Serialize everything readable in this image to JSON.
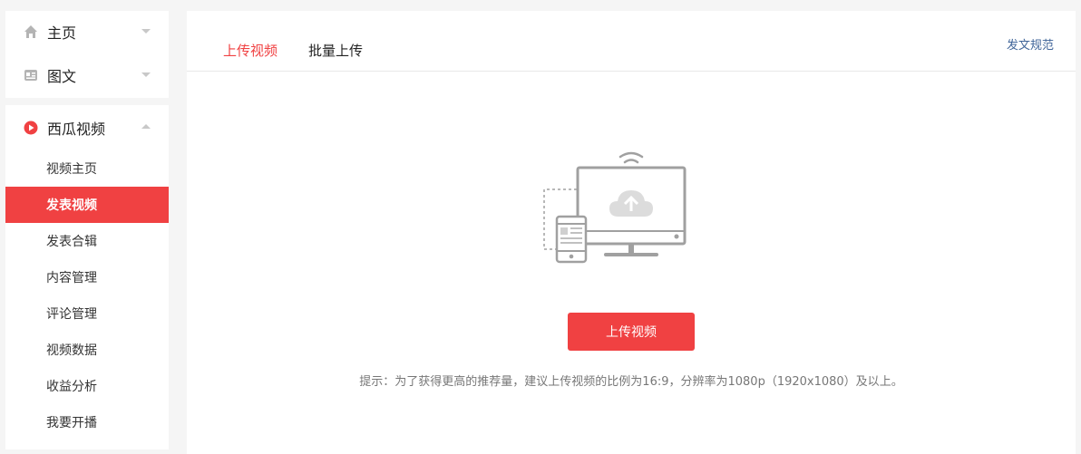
{
  "sidebar": {
    "top_items": [
      {
        "label": "主页",
        "icon": "home-icon"
      },
      {
        "label": "图文",
        "icon": "article-icon"
      }
    ],
    "video_section": {
      "label": "西瓜视频",
      "icon": "xigua-video-icon",
      "items": [
        {
          "label": "视频主页"
        },
        {
          "label": "发表视频",
          "active": true
        },
        {
          "label": "发表合辑"
        },
        {
          "label": "内容管理"
        },
        {
          "label": "评论管理"
        },
        {
          "label": "视频数据"
        },
        {
          "label": "收益分析"
        },
        {
          "label": "我要开播"
        }
      ]
    }
  },
  "main": {
    "tabs": [
      {
        "label": "上传视频",
        "active": true
      },
      {
        "label": "批量上传",
        "active": false
      }
    ],
    "rules_link": "发文规范",
    "upload_button": "上传视频",
    "hint": "提示：为了获得更高的推荐量，建议上传视频的比例为16:9，分辨率为1080p（1920x1080）及以上。"
  },
  "colors": {
    "accent": "#f04142",
    "link": "#406599",
    "illustration": "#a0a0a0"
  }
}
